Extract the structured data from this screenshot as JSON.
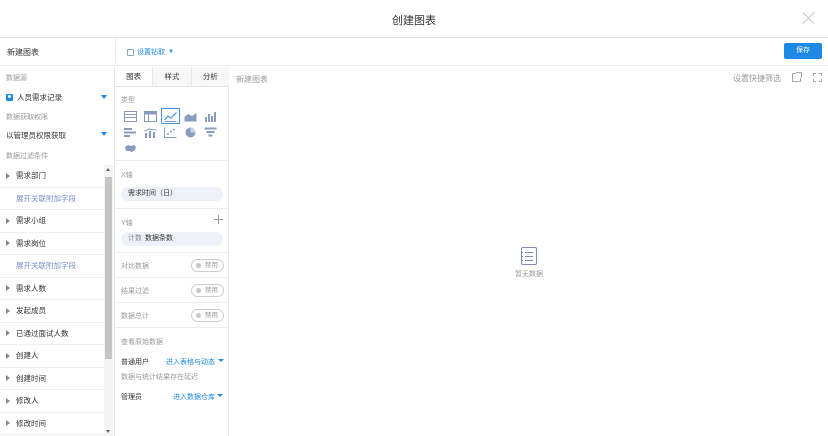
{
  "header": {
    "title": "创建图表"
  },
  "toolbar": {
    "chart_name": "新建图表",
    "drill_label": "设置钻取",
    "save_label": "保存"
  },
  "left": {
    "datasource_label": "数据源",
    "datasource_value": "人员需求记录",
    "permission_label": "数据获取权限",
    "permission_value": "以管理员权限获取",
    "filter_label": "数据过滤条件",
    "filters": [
      {
        "label": "需求部门",
        "kind": "field"
      },
      {
        "label": "展开关联附加字段",
        "kind": "link"
      },
      {
        "label": "需求小组",
        "kind": "field"
      },
      {
        "label": "需求岗位",
        "kind": "field"
      },
      {
        "label": "展开关联附加字段",
        "kind": "link"
      },
      {
        "label": "需求人数",
        "kind": "field"
      },
      {
        "label": "发起成员",
        "kind": "field"
      },
      {
        "label": "已通过面试人数",
        "kind": "field"
      },
      {
        "label": "创建人",
        "kind": "field"
      },
      {
        "label": "创建时间",
        "kind": "field"
      },
      {
        "label": "修改人",
        "kind": "field"
      },
      {
        "label": "修改时间",
        "kind": "field"
      }
    ]
  },
  "config": {
    "tabs": [
      {
        "label": "图表",
        "active": true
      },
      {
        "label": "样式",
        "active": false
      },
      {
        "label": "分析",
        "active": false
      }
    ],
    "type_label": "类型",
    "chart_types": [
      "table-icon",
      "pivot-table-icon",
      "line-chart-icon",
      "area-chart-icon",
      "column-chart-icon",
      "bar-chart-icon",
      "combo-chart-icon",
      "scatter-chart-icon",
      "pie-chart-icon",
      "funnel-chart-icon",
      "map-chart-icon"
    ],
    "selected_type": "line-chart-icon",
    "x_axis_label": "X轴",
    "x_axis_value": "需求时间（日）",
    "y_axis_label": "Y轴",
    "y_axis_prefix": "计数",
    "y_axis_value": "数据条数",
    "compare_label": "对比数据",
    "compare_value": "禁用",
    "result_filter_label": "结果过滤",
    "result_filter_value": "禁用",
    "total_label": "数据总计",
    "total_value": "禁用",
    "raw_label": "查看原始数据",
    "normal_user_label": "普通用户",
    "normal_user_value": "进入表格与动态",
    "delay_note": "数据与统计结果存在延迟",
    "admin_label": "管理员",
    "admin_value": "进入数据仓库"
  },
  "canvas": {
    "chart_name": "新建图表",
    "quick_filter_label": "设置快捷筛选",
    "empty_text": "暂无数据"
  },
  "colors": {
    "accent": "#1e88e5",
    "link_purple": "#7a8cd0",
    "muted": "#999999"
  }
}
